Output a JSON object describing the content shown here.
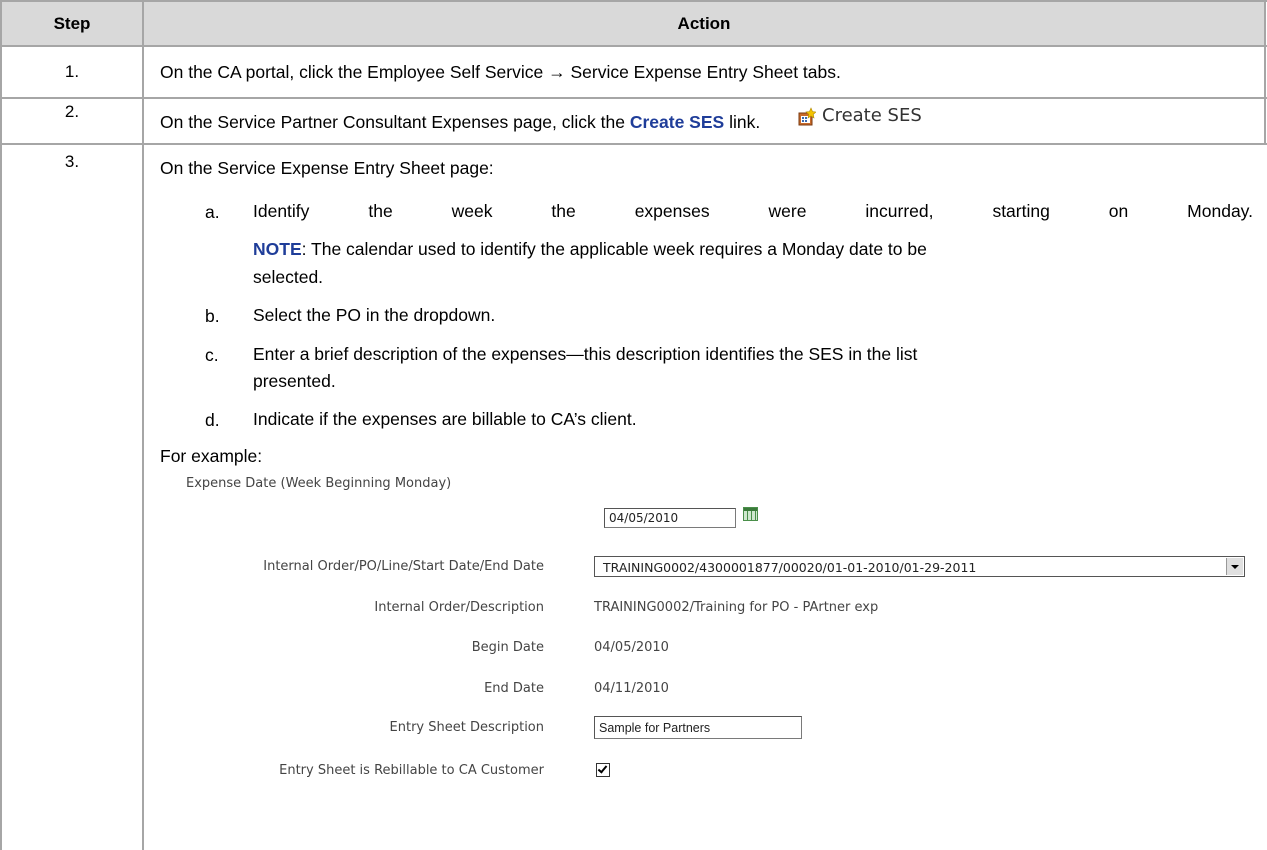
{
  "header": {
    "step_label": "Step",
    "action_label": "Action"
  },
  "rows": [
    {
      "step": "1.",
      "text": "On the CA portal, click the Employee Self Service → Service Expense Entry Sheet tabs."
    },
    {
      "step": "2.",
      "text_before": "On the Service Partner Consultant Expenses page, click the ",
      "link_text": "Create SES",
      "text_after": " link.",
      "icon_label": "Create SES"
    },
    {
      "step": "3.",
      "intro": "On the Service Expense Entry Sheet page:"
    }
  ],
  "list": [
    {
      "letter": "a.",
      "line1": "Identify the week the expenses were incurred, starting on Monday.",
      "note_label": "NOTE",
      "line2_rest": ": The calendar used to identify the applicable week requires a Monday date to be",
      "line3": "selected."
    },
    {
      "letter": "b.",
      "line1": "Select the PO in the dropdown."
    },
    {
      "letter": "c.",
      "line1": "Enter a brief description of the expenses—this description identifies the SES in the list",
      "line2": "presented."
    },
    {
      "letter": "d.",
      "line1": "Indicate if the expenses are billable to CA’s client."
    }
  ],
  "example_label": "For example:",
  "form": {
    "expense_date_label": "Expense Date (Week Beginning Monday)",
    "expense_date_value": "04/05/2010",
    "order_label": "Internal Order/PO/Line/Start Date/End Date",
    "order_value": "TRAINING0002/4300001877/00020/01-01-2010/01-29-2011",
    "order_desc_label": "Internal Order/Description",
    "order_desc_value": "TRAINING0002/Training for PO - PArtner exp",
    "begin_label": "Begin Date",
    "begin_value": "04/05/2010",
    "end_label": "End Date",
    "end_value": "04/11/2010",
    "sheet_desc_label": "Entry Sheet Description",
    "sheet_desc_value": "Sample for Partners",
    "rebillable_label": "Entry Sheet is Rebillable to CA Customer",
    "rebillable_checked": true
  },
  "colors": {
    "border": "#a6a6a6",
    "header_bg": "#d9d9d9",
    "link_blue": "#1f3d99"
  }
}
